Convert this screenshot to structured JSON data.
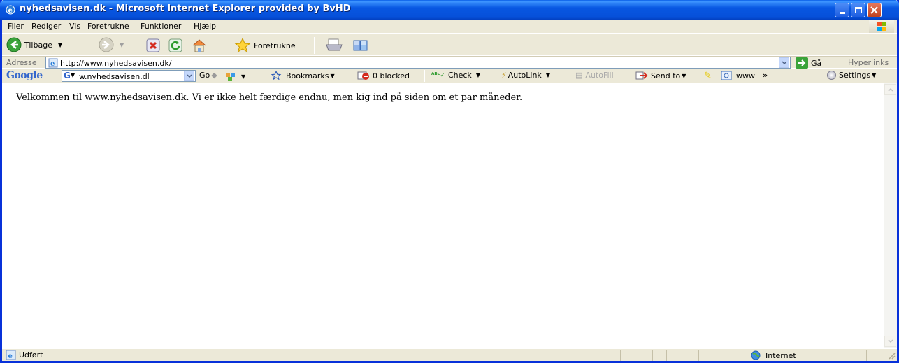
{
  "window": {
    "title": "nyhedsavisen.dk - Microsoft Internet Explorer provided by BvHD"
  },
  "menu": {
    "items": [
      "Filer",
      "Rediger",
      "Vis",
      "Foretrukne",
      "Funktioner",
      "Hjælp"
    ]
  },
  "toolbar": {
    "back_label": "Tilbage",
    "favorites_label": "Foretrukne"
  },
  "address": {
    "label": "Adresse",
    "url": "http://www.nyhedsavisen.dk/",
    "go_label": "Gå",
    "links_label": "Hyperlinks"
  },
  "google_toolbar": {
    "logo": "Google",
    "search_value": "w.nyhedsavisen.dl",
    "go_label": "Go",
    "bookmarks_label": "Bookmarks",
    "blocked_label": "0 blocked",
    "check_label": "Check",
    "autolink_label": "AutoLink",
    "autofill_label": "AutoFill",
    "sendto_label": "Send to",
    "www_label": "www",
    "more_label": "»",
    "settings_label": "Settings"
  },
  "page": {
    "message": "Velkommen til www.nyhedsavisen.dk. Vi er ikke helt færdige endnu, men kig ind på siden om et par måneder."
  },
  "status": {
    "text": "Udført",
    "zone": "Internet"
  }
}
